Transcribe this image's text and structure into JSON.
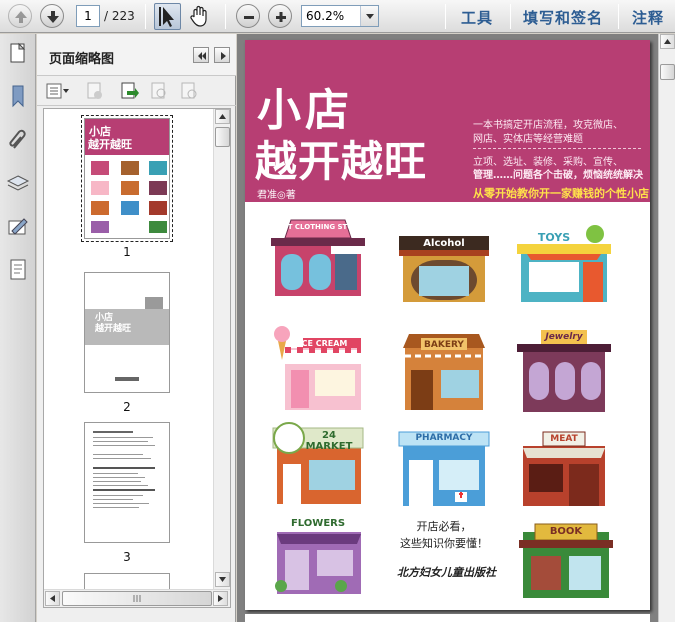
{
  "toolbar": {
    "page_current": "1",
    "page_total": "/ 223",
    "zoom": "60.2%",
    "menu_tools": "工具",
    "menu_fill_sign": "填写和签名",
    "menu_comment": "注释"
  },
  "panel": {
    "title": "页面缩略图",
    "thumbs": [
      {
        "num": "1"
      },
      {
        "num": "2"
      },
      {
        "num": "3"
      }
    ],
    "thumb2_logo": "小店\n越开越旺"
  },
  "cover": {
    "title_line1": "小店",
    "title_line2": "越开越旺",
    "desc_line1": "一本书搞定开店流程，攻克微店、",
    "desc_line2": "网店、实体店等经营难题",
    "desc_line3": "立项、选址、装修、采购、宣传、",
    "desc_line4": "管理……问题各个击破，烦恼统统解决",
    "author": "君准◎著",
    "slogan": "从零开始教你开一家赚钱的个性小店",
    "mid_line1": "开店必看，",
    "mid_line2": "这些知识你要懂！",
    "publisher": "北方妇女儿童出版社"
  },
  "shops": [
    {
      "sign": "BEST CLOTHING STORE"
    },
    {
      "sign": "Alcohol"
    },
    {
      "sign": "TOYS"
    },
    {
      "sign": "ICE CREAM"
    },
    {
      "sign": "BAKERY"
    },
    {
      "sign": "Jewelry"
    },
    {
      "sign": "24 MARKET"
    },
    {
      "sign": "PHARMACY"
    },
    {
      "sign": "MEAT"
    },
    {
      "sign": "FLOWERS"
    },
    {
      "sign": "BOOK"
    }
  ],
  "colors": {
    "cover_magenta": "#b73e73",
    "slogan_yellow": "#ffe14a",
    "menu_blue": "#2d5d93"
  }
}
